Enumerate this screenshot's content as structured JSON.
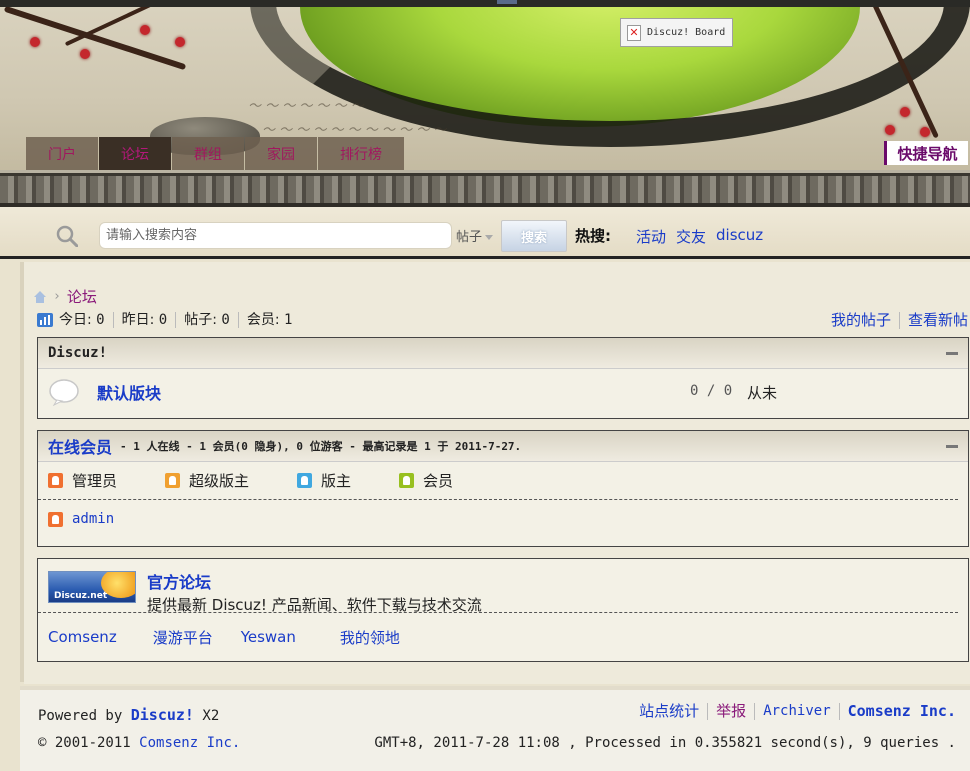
{
  "header": {
    "logo_alt": "Discuz! Board",
    "nav": [
      {
        "label": "门户"
      },
      {
        "label": "论坛"
      },
      {
        "label": "群组"
      },
      {
        "label": "家园"
      },
      {
        "label": "排行榜"
      }
    ],
    "quick_nav": "快捷导航"
  },
  "search": {
    "placeholder": "请输入搜索内容",
    "type": "帖子",
    "button": "搜索",
    "hot_label": "热搜:",
    "hot": [
      "活动",
      "交友",
      "discuz"
    ]
  },
  "breadcrumb": {
    "current": "论坛"
  },
  "stats": {
    "today_label": "今日:",
    "today": "0",
    "yesterday_label": "昨日:",
    "yesterday": "0",
    "posts_label": "帖子:",
    "posts": "0",
    "members_label": "会员:",
    "members": "1"
  },
  "top_links": {
    "my_posts": "我的帖子",
    "new_posts": "查看新帖"
  },
  "category": {
    "title": "Discuz!",
    "forum": {
      "name": "默认版块",
      "counts": "0 / 0",
      "last_post": "从未"
    }
  },
  "online": {
    "title": "在线会员",
    "summary": "- 1 人在线 - 1 会员(0 隐身), 0 位游客 - 最高记录是 1 于 2011-7-27.",
    "legend": [
      {
        "label": "管理员",
        "color": "#f07030"
      },
      {
        "label": "超级版主",
        "color": "#f0a030"
      },
      {
        "label": "版主",
        "color": "#40a8e0"
      },
      {
        "label": "会员",
        "color": "#98c020"
      }
    ],
    "users": [
      {
        "name": "admin",
        "color": "#f07030"
      }
    ]
  },
  "friend_links": {
    "logo_text": "Discuz.net",
    "official_title": "官方论坛",
    "official_desc": "提供最新 Discuz! 产品新闻、软件下载与技术交流",
    "links": [
      "Comsenz",
      "漫游平台",
      "Yeswan",
      "我的领地"
    ]
  },
  "footer": {
    "powered_prefix": "Powered by",
    "brand": "Discuz!",
    "version": "X2",
    "copyright_prefix": "© 2001-2011",
    "company": "Comsenz Inc.",
    "links": [
      "站点统计",
      "举报",
      "Archiver",
      "Comsenz Inc."
    ],
    "runtime": "GMT+8, 2011-7-28 11:08 , Processed in 0.355821 second(s), 9 queries ."
  },
  "colors": {
    "link": "#1a3cc8",
    "nav_text": "#a0185e",
    "visited": "#8a1a7a"
  }
}
